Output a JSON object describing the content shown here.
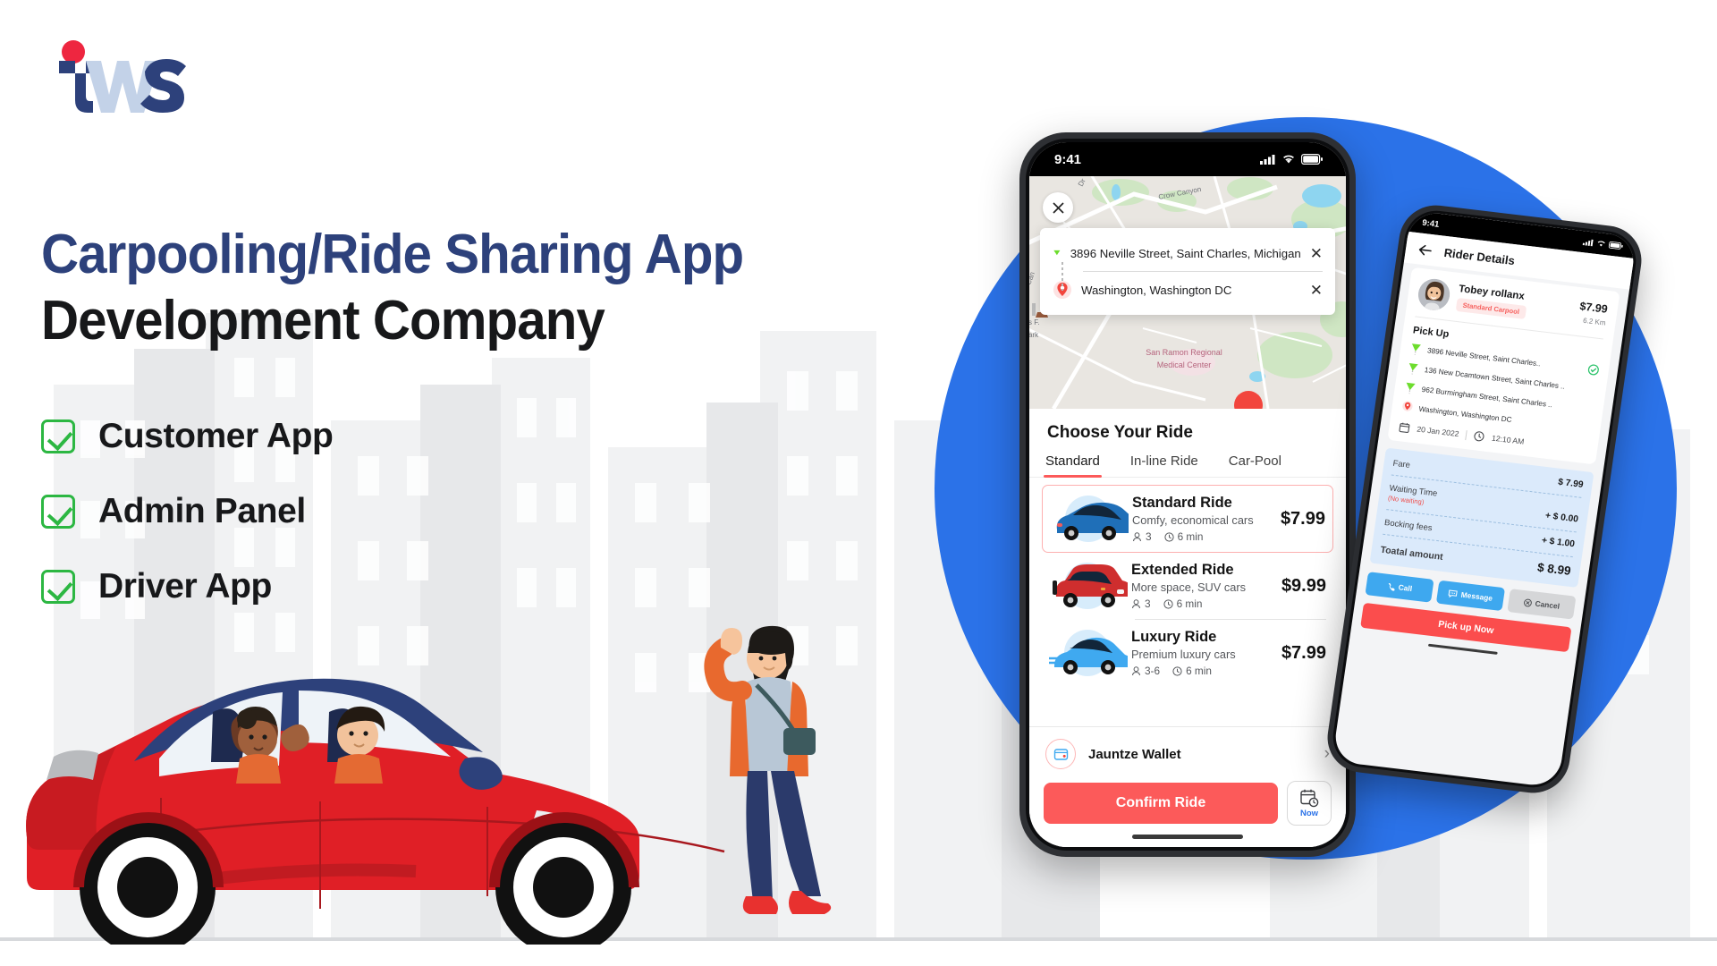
{
  "brand": {
    "logo_text": "tws",
    "navy": "#2d417b",
    "light_navy": "#c3d2e8",
    "red": "#ee2640"
  },
  "headline": {
    "line1": "Carpooling/Ride Sharing App",
    "line2": "Development Company"
  },
  "features": [
    {
      "label": "Customer App",
      "icon": "check-icon"
    },
    {
      "label": "Admin Panel",
      "icon": "check-icon"
    },
    {
      "label": "Driver App",
      "icon": "check-icon"
    }
  ],
  "colors": {
    "accent_blue": "#2b72e8",
    "accent_red": "#fc5a5a",
    "check_green": "#2cb742",
    "fare_box_blue": "#dbeafb"
  },
  "phone1": {
    "status": {
      "time": "9:41",
      "signal": "signal-icon",
      "wifi": "wifi-icon",
      "battery": "battery-icon"
    },
    "map": {
      "close_icon": "close-icon",
      "labels": [
        "Crow Canyon",
        "San Ramon Regional",
        "Medical Center",
        "Can",
        "Dr",
        "s F.",
        "ark"
      ]
    },
    "addresses": [
      {
        "icon": "pickup-marker-icon",
        "text": "3896 Neville Street, Saint Charles, Michigan",
        "clear": "close-icon"
      },
      {
        "icon": "destination-pin-icon",
        "text": "Washington, Washington DC",
        "clear": "close-icon"
      }
    ],
    "sheet_title": "Choose Your Ride",
    "tabs": [
      {
        "label": "Standard",
        "active": true
      },
      {
        "label": "In-line Ride",
        "active": false
      },
      {
        "label": "Car-Pool",
        "active": false
      }
    ],
    "rides": [
      {
        "name": "Standard Ride",
        "desc": "Comfy, economical cars",
        "seats": "3",
        "eta": "6 min",
        "price": "$7.99",
        "selected": true,
        "car_color": "#1f6fb8"
      },
      {
        "name": "Extended Ride",
        "desc": "More space, SUV cars",
        "seats": "3",
        "eta": "6 min",
        "price": "$9.99",
        "selected": false,
        "car_color": "#cf2e2e"
      },
      {
        "name": "Luxury Ride",
        "desc": "Premium luxury cars",
        "seats": "3-6",
        "eta": "6 min",
        "price": "$7.99",
        "selected": false,
        "car_color": "#3fa9f0"
      }
    ],
    "wallet": {
      "label": "Jauntze Wallet",
      "icon": "wallet-icon",
      "chevron": "chevron-right-icon"
    },
    "confirm_label": "Confirm Ride",
    "now_label": "Now"
  },
  "phone2": {
    "status": {
      "time": "9:41"
    },
    "nav_title": "Rider Details",
    "back_icon": "arrow-left-icon",
    "rider": {
      "name": "Tobey rollanx",
      "badge": "Standard Carpool",
      "price": "$7.99",
      "distance": "6.2 Km"
    },
    "pickup_heading": "Pick Up",
    "stops": [
      {
        "text": "3896 Neville Street, Saint Charles..",
        "type": "pickup",
        "verified": true
      },
      {
        "text": "136 New Dcamtown Street, Saint Charles ..",
        "type": "pickup",
        "verified": false
      },
      {
        "text": "962 Burmingham Street, Saint Charles ..",
        "type": "pickup",
        "verified": false
      },
      {
        "text": "Washington, Washington DC",
        "type": "destination",
        "verified": false
      }
    ],
    "date": "20 Jan 2022",
    "time": "12:10 AM",
    "fare_rows": [
      {
        "label": "Fare",
        "sub": "",
        "value": "$ 7.99"
      },
      {
        "label": "Waiting Time",
        "sub": "(No waiting)",
        "value": "+  $ 0.00"
      },
      {
        "label": "Bocking fees",
        "sub": "",
        "value": "+  $ 1.00"
      },
      {
        "label": "Toatal amount",
        "sub": "",
        "value": "$ 8.99"
      }
    ],
    "actions": [
      {
        "label": "Call",
        "icon": "phone-icon",
        "style": "blue"
      },
      {
        "label": "Message",
        "icon": "message-icon",
        "style": "blue"
      },
      {
        "label": "Cancel",
        "icon": "cancel-icon",
        "style": "gray"
      }
    ],
    "pickup_button": "Pick up Now"
  },
  "illustration": {
    "car": "red-sedan-with-two-passengers",
    "pedestrian": "waving-woman",
    "background": "faint-city-skyline"
  }
}
